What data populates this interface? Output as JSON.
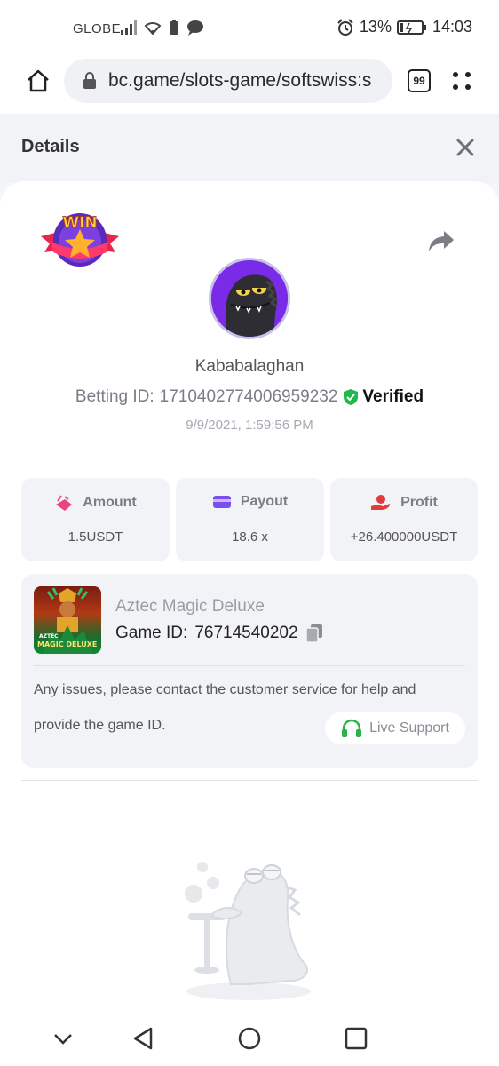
{
  "status_bar": {
    "carrier": "GLOBE",
    "battery": "13%",
    "time": "14:03"
  },
  "browser": {
    "url": "bc.game/slots-game/softswiss:s",
    "tab_count": "99"
  },
  "details": {
    "title": "Details"
  },
  "bet": {
    "username": "Kababalaghan",
    "betting_id_label": "Betting ID:",
    "betting_id": "1710402774006959232",
    "verified_label": "Verified",
    "timestamp": "9/9/2021, 1:59:56 PM",
    "badge_text": "WIN"
  },
  "stats": [
    {
      "label": "Amount",
      "value": "1.5USDT",
      "icon": "amount-icon",
      "color": "#e8457a"
    },
    {
      "label": "Payout",
      "value": "18.6 x",
      "icon": "payout-card-icon",
      "color": "#7b4ef0"
    },
    {
      "label": "Profit",
      "value": "+26.400000USDT",
      "icon": "profit-hand-icon",
      "color": "#e23b3b"
    }
  ],
  "game": {
    "name": "Aztec Magic Deluxe",
    "id_label": "Game ID:",
    "id": "76714540202",
    "thumb_line1": "AZTEC",
    "thumb_line2": "MAGIC DELUXE",
    "issues_line1": "Any issues, please contact the customer service for help and",
    "issues_line2": "provide the game ID.",
    "live_support_label": "Live Support"
  },
  "colors": {
    "verified_green": "#1fb84a",
    "support_green": "#2bb24c",
    "avatar_purple": "#7a2be8"
  }
}
